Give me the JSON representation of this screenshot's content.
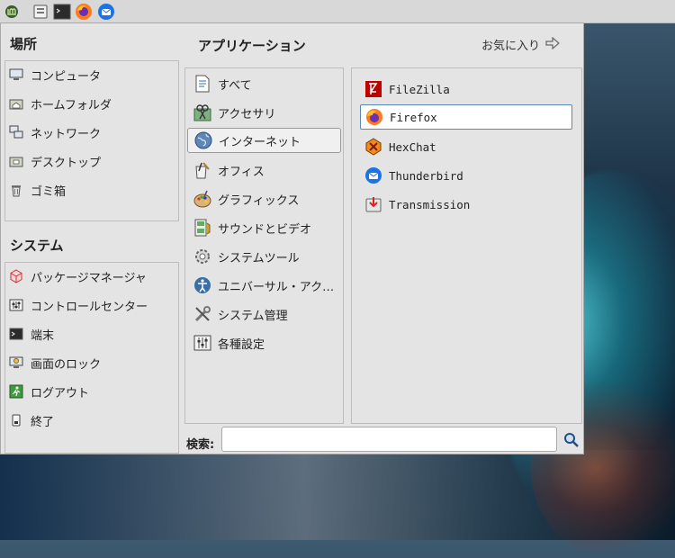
{
  "panel": {
    "launchers": [
      {
        "icon": "mint-menu-icon"
      },
      {
        "icon": "file-manager-icon"
      },
      {
        "icon": "terminal-icon"
      },
      {
        "icon": "firefox-icon"
      },
      {
        "icon": "thunderbird-icon"
      }
    ]
  },
  "places": {
    "title": "場所",
    "items": [
      {
        "label": "コンピュータ",
        "icon": "computer-icon"
      },
      {
        "label": "ホームフォルダ",
        "icon": "home-folder-icon"
      },
      {
        "label": "ネットワーク",
        "icon": "network-icon"
      },
      {
        "label": "デスクトップ",
        "icon": "desktop-folder-icon"
      },
      {
        "label": "ゴミ箱",
        "icon": "trash-icon"
      }
    ]
  },
  "system": {
    "title": "システム",
    "items": [
      {
        "label": "パッケージマネージャ",
        "icon": "package-manager-icon"
      },
      {
        "label": "コントロールセンター",
        "icon": "control-center-icon"
      },
      {
        "label": "端末",
        "icon": "terminal-icon"
      },
      {
        "label": "画面のロック",
        "icon": "lock-screen-icon"
      },
      {
        "label": "ログアウト",
        "icon": "logout-icon"
      },
      {
        "label": "終了",
        "icon": "shutdown-icon"
      }
    ]
  },
  "applications": {
    "title": "アプリケーション",
    "favorites_label": "お気に入り",
    "categories": [
      {
        "label": "すべて",
        "icon": "all-apps-icon"
      },
      {
        "label": "アクセサリ",
        "icon": "accessories-icon"
      },
      {
        "label": "インターネット",
        "icon": "internet-globe-icon",
        "selected": true
      },
      {
        "label": "オフィス",
        "icon": "office-icon"
      },
      {
        "label": "グラフィックス",
        "icon": "graphics-palette-icon"
      },
      {
        "label": "サウンドとビデオ",
        "icon": "sound-video-icon"
      },
      {
        "label": "システムツール",
        "icon": "system-tools-gear-icon"
      },
      {
        "label": "ユニバーサル・アク…",
        "icon": "accessibility-icon"
      },
      {
        "label": "システム管理",
        "icon": "administration-tools-icon"
      },
      {
        "label": "各種設定",
        "icon": "settings-icon"
      }
    ],
    "apps": [
      {
        "label": "FileZilla",
        "icon": "filezilla-icon"
      },
      {
        "label": "Firefox",
        "icon": "firefox-icon",
        "selected": true
      },
      {
        "label": "HexChat",
        "icon": "hexchat-icon"
      },
      {
        "label": "Thunderbird",
        "icon": "thunderbird-icon"
      },
      {
        "label": "Transmission",
        "icon": "transmission-icon"
      }
    ]
  },
  "search": {
    "label": "検索:",
    "value": "",
    "placeholder": ""
  },
  "colors": {
    "selection_border": "#5c86b8",
    "menu_bg": "#e4e4e4"
  }
}
